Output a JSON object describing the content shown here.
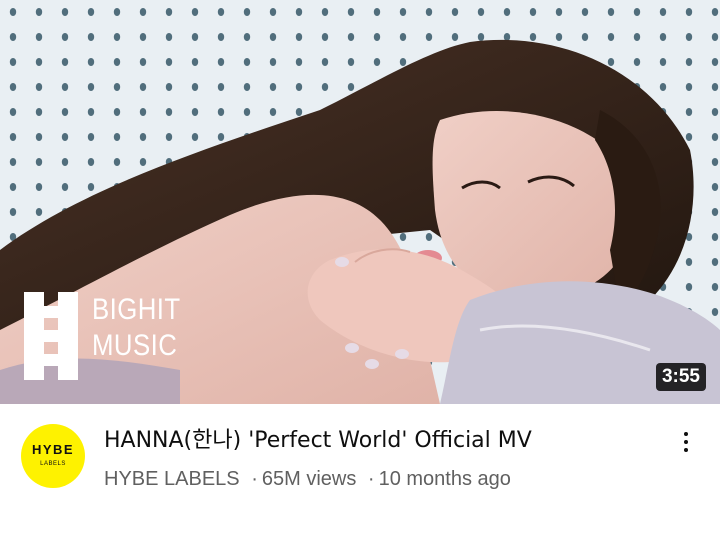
{
  "video": {
    "title": "HANNA(한나) 'Perfect World' Official MV",
    "channel": "HYBE LABELS",
    "separator": "·",
    "views": "65M views",
    "age": "10 months ago",
    "duration": "3:55"
  },
  "thumbnail": {
    "watermark_line1": "BIGHIT",
    "watermark_line2": "MUSIC"
  },
  "avatar": {
    "logo_text": "HYBE",
    "logo_subtext": "LABELS",
    "color": "#fef200"
  },
  "icons": {
    "more": "more-vert-icon"
  }
}
